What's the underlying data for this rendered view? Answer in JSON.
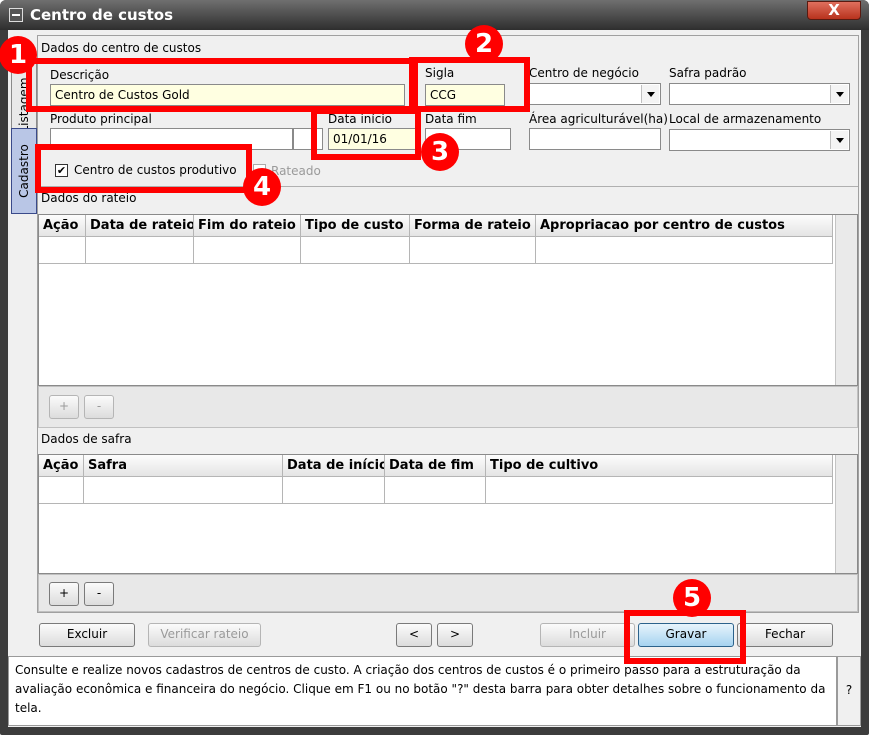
{
  "window": {
    "title": "Centro de custos",
    "close_label": "X"
  },
  "side_tabs": {
    "listagem": "Listagem",
    "cadastro": "Cadastro"
  },
  "sections": {
    "dados_centro": "Dados do centro de custos",
    "dados_rateio": "Dados do rateio",
    "dados_safra": "Dados de safra"
  },
  "fields": {
    "descricao": {
      "label": "Descrição",
      "value": "Centro de Custos Gold"
    },
    "sigla": {
      "label": "Sigla",
      "value": "CCG"
    },
    "centro_negocio": {
      "label": "Centro de negócio",
      "value": ""
    },
    "safra_padrao": {
      "label": "Safra padrão",
      "value": ""
    },
    "produto_principal": {
      "label": "Produto principal",
      "value": ""
    },
    "data_inicio": {
      "label": "Data início",
      "value": "01/01/16"
    },
    "data_fim": {
      "label": "Data fim",
      "value": ""
    },
    "area_agricultavel": {
      "label": "Área agriculturável(ha)",
      "value": ""
    },
    "local_armazenamento": {
      "label": "Local de armazenamento",
      "value": ""
    }
  },
  "checkboxes": {
    "produtivo": {
      "label": "Centro de custos produtivo",
      "checked": true,
      "mark": "✔"
    },
    "rateado": {
      "label": "Rateado",
      "checked": false
    }
  },
  "rateio_table": {
    "headers": [
      "Ação",
      "Data de rateio",
      "Fim do rateio",
      "Tipo de custo",
      "Forma de rateio",
      "Apropriacao por centro de custos"
    ]
  },
  "safra_table": {
    "headers": [
      "Ação",
      "Safra",
      "Data de início",
      "Data de fim",
      "Tipo de cultivo"
    ]
  },
  "grid_buttons": {
    "add": "+",
    "remove": "-"
  },
  "footer_buttons": {
    "excluir": "Excluir",
    "verificar_rateio": "Verificar rateio",
    "prev": "<",
    "next": ">",
    "incluir": "Incluir",
    "gravar": "Gravar",
    "fechar": "Fechar"
  },
  "help": {
    "text": "Consulte e realize novos cadastros de centros de custo. A criação dos centros de custos é o primeiro passo para a estruturação da avaliação econômica e financeira do negócio. Clique em F1 ou no botão \"?\" desta barra para obter detalhes sobre o funcionamento da tela.",
    "button": "?"
  },
  "annotations": [
    "1",
    "2",
    "3",
    "4",
    "5"
  ],
  "colors": {
    "annotation_red": "#ff0000",
    "required_field_bg": "#ffffe1",
    "active_tab": "#b9c6e6"
  }
}
